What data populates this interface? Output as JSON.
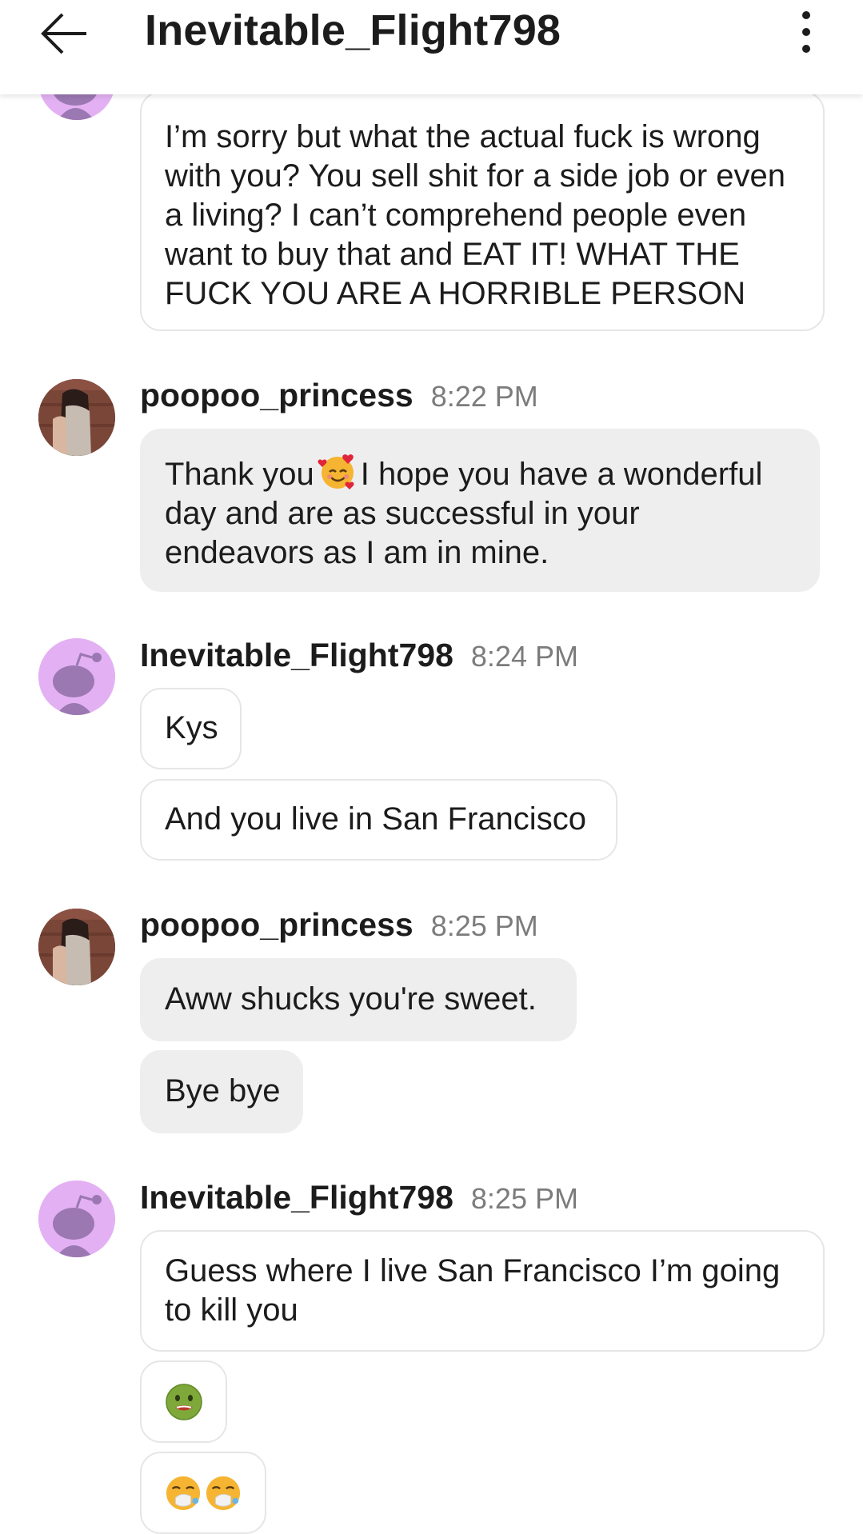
{
  "header": {
    "title": "Inevitable_Flight798"
  },
  "messages": {
    "m1": "I’m sorry but what the actual fuck is wrong with you? You sell shit for a side job or even a living? I can’t comprehend people even want to buy that and EAT IT! WHAT THE FUCK YOU ARE A HORRIBLE PERSON",
    "g2": {
      "user": "poopoo_princess",
      "time": "8:22 PM"
    },
    "m2a": "Thank you",
    "m2b": "I hope you have a wonderful day and are as successful in your endeavors as I am in mine.",
    "g3": {
      "user": "Inevitable_Flight798",
      "time": "8:24 PM"
    },
    "m3": "Kys",
    "m4": "And you live in San Francisco",
    "g4": {
      "user": "poopoo_princess",
      "time": "8:25 PM"
    },
    "m5": "Aww shucks you're sweet.",
    "m6": "Bye bye",
    "g5": {
      "user": "Inevitable_Flight798",
      "time": "8:25 PM"
    },
    "m7": "Guess where I live San Francisco I’m going to kill you",
    "m8_icon": "nauseated-face-emoji",
    "m9_icon": "sneezing-face-emoji"
  },
  "colors": {
    "snoo_bg": "#e3b1f3",
    "snoo_body": "#9b78b1",
    "incoming_bubble": "#eeeeee",
    "outgoing_border": "#e6e6e6",
    "timestamp": "#7c7c7c"
  }
}
